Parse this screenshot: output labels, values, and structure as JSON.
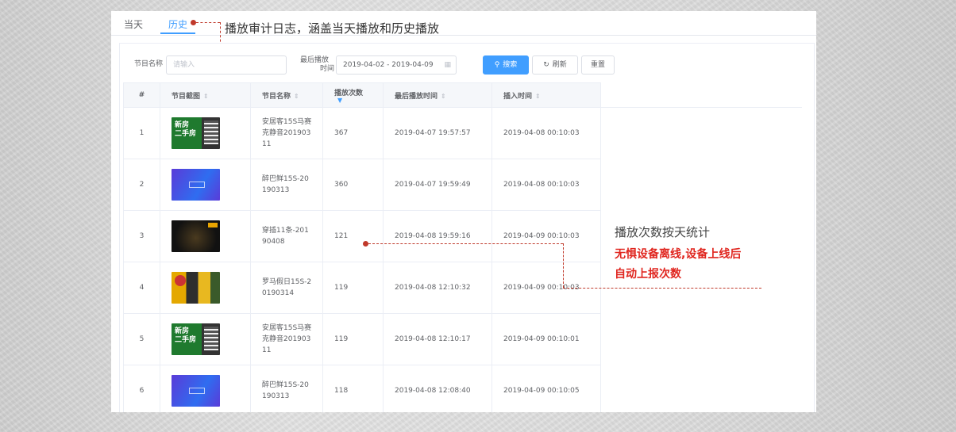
{
  "tabs": [
    {
      "label": "当天"
    },
    {
      "label": "历史"
    }
  ],
  "annotations": {
    "tab_callout": "播放审计日志，涵盖当天播放和历史播放",
    "side_title": "播放次数按天统计",
    "side_line1": "无惧设备离线,设备上线后",
    "side_line2": "自动上报次数",
    "accent_color": "#e0261f"
  },
  "search": {
    "name_label": "节目名称",
    "name_placeholder": "请输入",
    "last_play_label_1": "最后播放",
    "last_play_label_2": "时间",
    "date_range": "2019-04-02 - 2019-04-09",
    "search_button": "搜索",
    "refresh_button": "刷新",
    "reset_button": "重置"
  },
  "table": {
    "headers": {
      "index": "#",
      "thumbnail": "节目截图",
      "name": "节目名称",
      "play_count": "播放次数",
      "last_play": "最后播放时间",
      "inserted": "插入时间"
    },
    "rows": [
      {
        "index": "1",
        "thumb": "green",
        "thumb_text_1": "新房",
        "thumb_text_2": "二手房",
        "name": "安居客15S马赛克静音20190311",
        "play_count": "367",
        "last_play": "2019-04-07 19:57:57",
        "inserted": "2019-04-08 00:10:03"
      },
      {
        "index": "2",
        "thumb": "blue",
        "name": "醉巴鲜15S-20190313",
        "play_count": "360",
        "last_play": "2019-04-07 19:59:49",
        "inserted": "2019-04-08 00:10:03"
      },
      {
        "index": "3",
        "thumb": "dark",
        "name": "穿插11条-20190408",
        "play_count": "121",
        "last_play": "2019-04-08 19:59:16",
        "inserted": "2019-04-09 00:10:03"
      },
      {
        "index": "4",
        "thumb": "yellow",
        "name": "罗马假日15S-20190314",
        "play_count": "119",
        "last_play": "2019-04-08 12:10:32",
        "inserted": "2019-04-09 00:10:03"
      },
      {
        "index": "5",
        "thumb": "green",
        "thumb_text_1": "新房",
        "thumb_text_2": "二手房",
        "name": "安居客15S马赛克静音20190311",
        "play_count": "119",
        "last_play": "2019-04-08 12:10:17",
        "inserted": "2019-04-09 00:10:01"
      },
      {
        "index": "6",
        "thumb": "blue",
        "name": "醉巴鲜15S-20190313",
        "play_count": "118",
        "last_play": "2019-04-08 12:08:40",
        "inserted": "2019-04-09 00:10:05"
      }
    ]
  }
}
